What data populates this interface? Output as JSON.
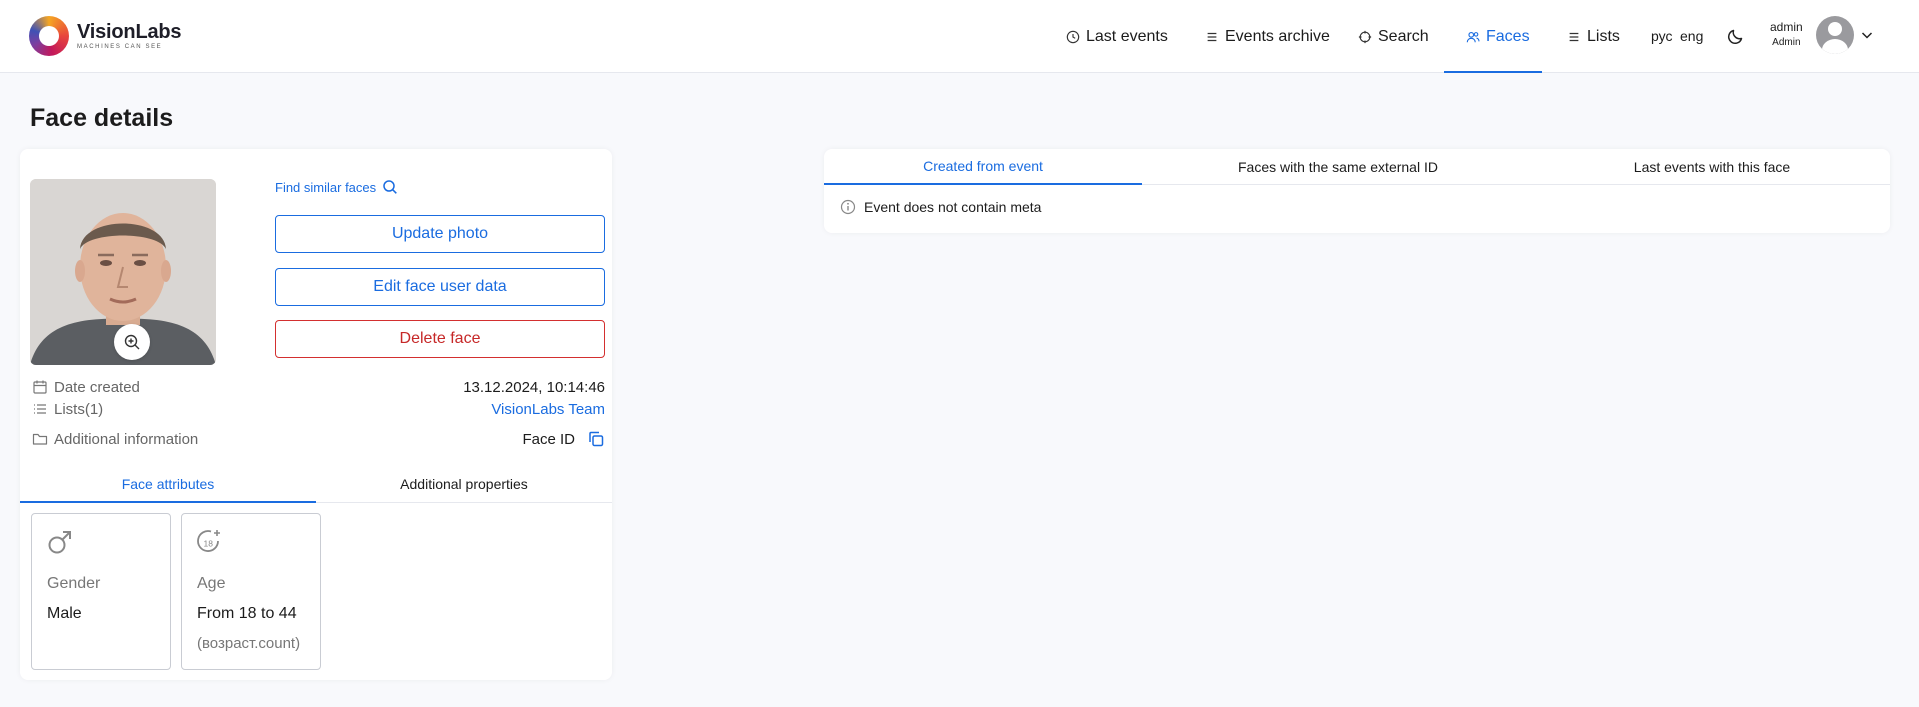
{
  "header": {
    "logo": {
      "name": "VisionLabs",
      "tagline": "MACHINES CAN SEE"
    },
    "nav": [
      {
        "label": "Last events"
      },
      {
        "label": "Events archive"
      },
      {
        "label": "Search"
      },
      {
        "label": "Faces",
        "active": true
      },
      {
        "label": "Lists"
      }
    ],
    "languages": [
      "рус",
      "eng"
    ],
    "user": {
      "name": "admin",
      "role": "Admin"
    }
  },
  "page": {
    "title": "Face details"
  },
  "face": {
    "find_similar_label": "Find similar faces",
    "buttons": {
      "update_photo": "Update photo",
      "edit_user_data": "Edit face user data",
      "delete_face": "Delete face"
    },
    "info": {
      "date_created_label": "Date created",
      "date_created_value": "13.12.2024, 10:14:46",
      "lists_label": "Lists(1)",
      "lists_value": "VisionLabs Team",
      "additional_label": "Additional information",
      "face_id_label": "Face ID"
    },
    "tabs": [
      {
        "label": "Face attributes",
        "active": true
      },
      {
        "label": "Additional properties"
      }
    ],
    "attributes": {
      "gender": {
        "label": "Gender",
        "value": "Male"
      },
      "age": {
        "label": "Age",
        "value": "From 18 to 44",
        "extra": "(возраст.count)",
        "badge": "18"
      }
    }
  },
  "right_panel": {
    "tabs": [
      {
        "label": "Created from event",
        "active": true
      },
      {
        "label": "Faces with the same external ID"
      },
      {
        "label": "Last events with this face"
      }
    ],
    "message": "Event does not contain meta"
  },
  "colors": {
    "accent": "#1a6ce0",
    "danger": "#c62828",
    "background": "#f8f9fc"
  }
}
